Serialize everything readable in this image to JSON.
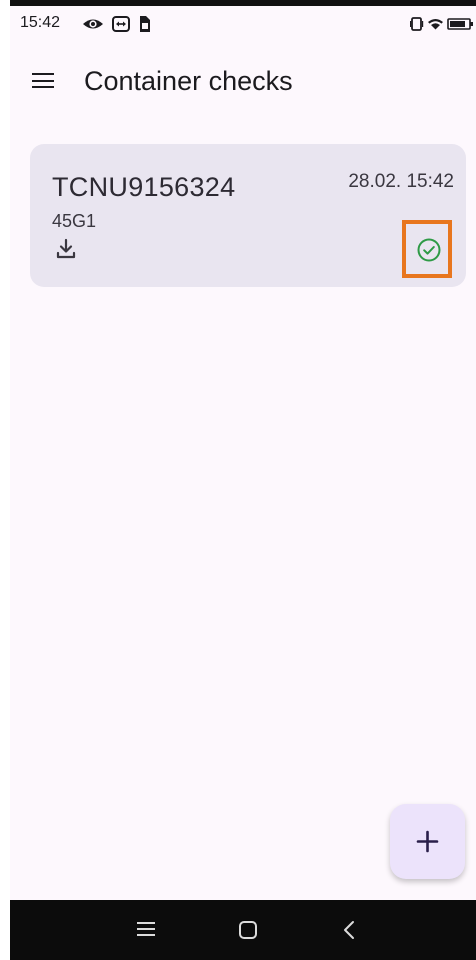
{
  "status_bar": {
    "time": "15:42",
    "icons_left": [
      "eye-icon",
      "teamviewer-icon",
      "sim-icon"
    ],
    "icons_right": [
      "vibrate-icon",
      "wifi-icon",
      "battery-icon"
    ]
  },
  "app_bar": {
    "menu_icon": "hamburger-menu-icon",
    "title": "Container checks"
  },
  "checks": [
    {
      "container_number": "TCNU9156324",
      "iso_code": "45G1",
      "datetime": "28.02. 15:42",
      "download_icon": "download-icon",
      "status_icon": "check-circle-icon"
    }
  ],
  "fab": {
    "icon": "plus-icon"
  },
  "nav_bar": {
    "icons": [
      "recents-icon",
      "home-icon",
      "back-icon"
    ]
  },
  "colors": {
    "background": "#fdf8fd",
    "card": "#e9e5f0",
    "success": "#2e9a46",
    "highlight": "#e8761e",
    "fab": "#ece3fb"
  }
}
